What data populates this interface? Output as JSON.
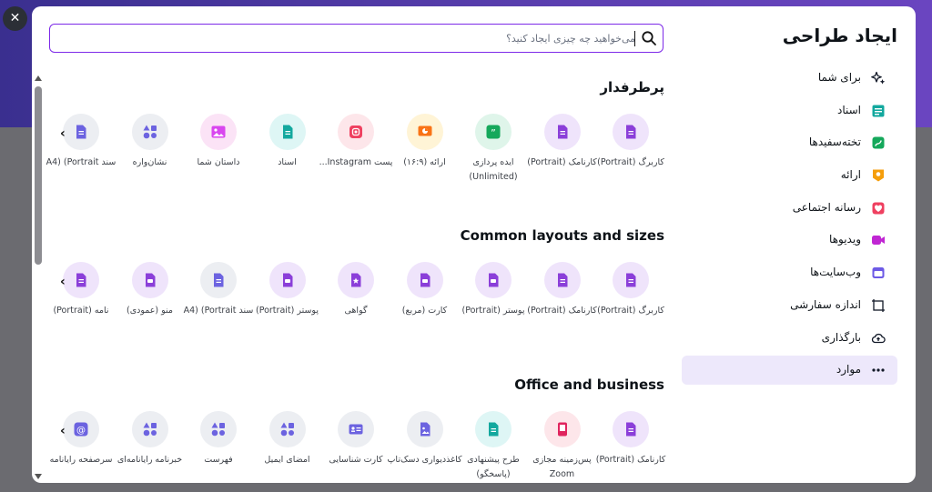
{
  "close_label": "✕",
  "sidebar": {
    "title": "ایجاد طراحی",
    "items": [
      {
        "label": "برای شما",
        "icon": "sparkles-icon",
        "color": "#111827"
      },
      {
        "label": "اسناد",
        "icon": "doc-icon",
        "color": "#13a89e"
      },
      {
        "label": "تخته‌سفیدها",
        "icon": "whiteboard-icon",
        "color": "#15a85b"
      },
      {
        "label": "ارائه",
        "icon": "presentation-icon",
        "color": "#f59e0b"
      },
      {
        "label": "رسانه اجتماعی",
        "icon": "heart-icon",
        "color": "#ef4060"
      },
      {
        "label": "ویدیوها",
        "icon": "video-icon",
        "color": "#c026d3"
      },
      {
        "label": "وب‌سایت‌ها",
        "icon": "website-icon",
        "color": "#6d5ae6"
      },
      {
        "label": "اندازه سفارشی",
        "icon": "custom-size-icon",
        "color": "#111827"
      },
      {
        "label": "بارگذاری",
        "icon": "upload-cloud-icon",
        "color": "#111827"
      },
      {
        "label": "موارد",
        "icon": "more-icon",
        "color": "#111827"
      }
    ]
  },
  "search": {
    "placeholder": "می‌خواهید چه چیزی ایجاد کنید؟"
  },
  "sections": [
    {
      "title": "پرطرفدار",
      "tiles": [
        {
          "label": "کاربرگ (Portrait)",
          "bg": "#efe4fb",
          "fg": "#8b3fd9",
          "icon": "doc-icon"
        },
        {
          "label": "کارنامک (Portrait)",
          "bg": "#efe4fb",
          "fg": "#8b3fd9",
          "icon": "doc-icon"
        },
        {
          "label": "ایده پردازی (Unlimited)",
          "bg": "#dff5ea",
          "fg": "#15a85b",
          "icon": "quote-icon"
        },
        {
          "label": "ارائه (۱۶:۹)",
          "bg": "#fff4d6",
          "fg": "#f97316",
          "icon": "presentation-icon"
        },
        {
          "label": "پست Instagram...",
          "bg": "#fde6ea",
          "fg": "#ef4060",
          "icon": "instagram-icon"
        },
        {
          "label": "اسناد",
          "bg": "#def6f5",
          "fg": "#13a89e",
          "icon": "doc-icon"
        },
        {
          "label": "داستان شما",
          "bg": "#fbe3f6",
          "fg": "#d946ef",
          "icon": "image-icon"
        },
        {
          "label": "نشان‌واره",
          "bg": "#eceef2",
          "fg": "#6c63e0",
          "icon": "shapes-icon"
        },
        {
          "label": "سند A4) (Portrait",
          "bg": "#eceef2",
          "fg": "#6c63e0",
          "icon": "doc-icon"
        }
      ]
    },
    {
      "title": "Common layouts and sizes",
      "tiles": [
        {
          "label": "کاربرگ (Portrait)",
          "bg": "#efe4fb",
          "fg": "#8b3fd9",
          "icon": "doc-icon"
        },
        {
          "label": "کارنامک (Portrait)",
          "bg": "#efe4fb",
          "fg": "#8b3fd9",
          "icon": "doc-icon"
        },
        {
          "label": "پوستر (Portrait)",
          "bg": "#efe4fb",
          "fg": "#8b3fd9",
          "icon": "print-icon"
        },
        {
          "label": "کارت (مربع)",
          "bg": "#efe4fb",
          "fg": "#8b3fd9",
          "icon": "print-icon"
        },
        {
          "label": "گواهی",
          "bg": "#efe4fb",
          "fg": "#8b3fd9",
          "icon": "certificate-icon"
        },
        {
          "label": "پوستر (Portrait)",
          "bg": "#efe4fb",
          "fg": "#8b3fd9",
          "icon": "print-icon"
        },
        {
          "label": "سند A4) (Portrait",
          "bg": "#eceef2",
          "fg": "#6c63e0",
          "icon": "doc-icon"
        },
        {
          "label": "منو (عمودی)",
          "bg": "#efe4fb",
          "fg": "#8b3fd9",
          "icon": "print-icon"
        },
        {
          "label": "نامه (Portrait)",
          "bg": "#efe4fb",
          "fg": "#8b3fd9",
          "icon": "doc-icon"
        }
      ]
    },
    {
      "title": "Office and business",
      "tiles": [
        {
          "label": "کارنامک (Portrait)",
          "bg": "#efe4fb",
          "fg": "#8b3fd9",
          "icon": "doc-icon"
        },
        {
          "label": "پس‌زمینه مجازی Zoom",
          "bg": "#fde6ea",
          "fg": "#e0245e",
          "icon": "phone-icon"
        },
        {
          "label": "طرح پیشنهادی (پاسخگو)",
          "bg": "#def6f5",
          "fg": "#13a89e",
          "icon": "doc-icon"
        },
        {
          "label": "کاغذدیواری دسک‌تاپ",
          "bg": "#eceef2",
          "fg": "#6c63e0",
          "icon": "wallpaper-icon"
        },
        {
          "label": "کارت شناسایی",
          "bg": "#eceef2",
          "fg": "#6c63e0",
          "icon": "id-card-icon"
        },
        {
          "label": "امضای ایمیل",
          "bg": "#eceef2",
          "fg": "#6c63e0",
          "icon": "shapes-icon"
        },
        {
          "label": "فهرست",
          "bg": "#eceef2",
          "fg": "#6c63e0",
          "icon": "shapes-icon"
        },
        {
          "label": "خبرنامه رایانامه‌ای",
          "bg": "#eceef2",
          "fg": "#6c63e0",
          "icon": "shapes-icon"
        },
        {
          "label": "سرصفحه رایانامه",
          "bg": "#eceef2",
          "fg": "#6c63e0",
          "icon": "at-icon"
        }
      ]
    }
  ]
}
